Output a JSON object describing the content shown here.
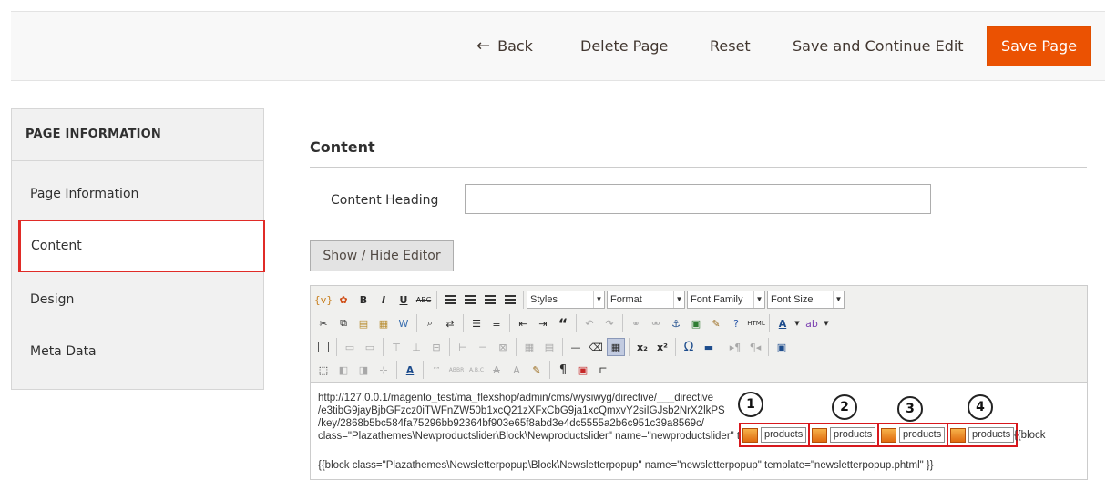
{
  "actions": {
    "back": "Back",
    "delete": "Delete Page",
    "reset": "Reset",
    "save_continue": "Save and Continue Edit",
    "save": "Save Page"
  },
  "sidebar": {
    "title": "PAGE INFORMATION",
    "items": [
      {
        "label": "Page Information"
      },
      {
        "label": "Content"
      },
      {
        "label": "Design"
      },
      {
        "label": "Meta Data"
      }
    ]
  },
  "main": {
    "section_title": "Content",
    "content_heading_label": "Content Heading",
    "content_heading_value": "",
    "toggle_editor": "Show / Hide Editor"
  },
  "editor": {
    "dropdowns": [
      "Styles",
      "Format",
      "Font Family",
      "Font Size"
    ],
    "text": {
      "line1": "http://127.0.0.1/magento_test/ma_flexshop/admin/cms/wysiwyg/directive/___directive",
      "line2": "/e3tibG9jayBjbGFzcz0iTWFnZW50b1xcQ21zXFxCbG9ja1xcQmxvY2siIGJsb2NrX2lkPS",
      "line3": "/key/2868b5bc584fa75296bb92364bf903e65f8abd3e4dc5555a2b6c951c39a8569c/",
      "tail_block": "{{block",
      "line4": "class=\"Plazathemes\\Newproductslider\\Block\\Newproductslider\" name=\"newproductslider\" template=\"newproductslider.phtml\" }}",
      "line5": "{{block class=\"Plazathemes\\Newsletterpopup\\Block\\Newsletterpopup\" name=\"newsletterpopup\" template=\"newsletterpopup.phtml\" }}"
    },
    "widgets": [
      {
        "label": "products",
        "number": "1"
      },
      {
        "label": "products",
        "number": "2"
      },
      {
        "label": "products",
        "number": "3"
      },
      {
        "label": "products",
        "number": "4"
      }
    ]
  },
  "colors": {
    "accent": "#eb5202",
    "highlight": "#e02b27"
  }
}
